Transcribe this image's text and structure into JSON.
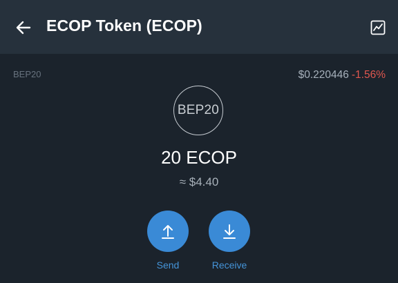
{
  "header": {
    "title": "ECOP Token (ECOP)",
    "back_icon": "arrow-left-icon",
    "chart_icon": "line-chart-icon"
  },
  "token": {
    "network": "BEP20",
    "price": "$0.220446",
    "change": "-1.56%",
    "logo_text": "BEP20",
    "balance": "20 ECOP",
    "fiat_value": "≈ $4.40"
  },
  "actions": {
    "send_label": "Send",
    "receive_label": "Receive"
  },
  "colors": {
    "background": "#1b232c",
    "header": "#26313c",
    "accent": "#3a8ad6",
    "negative": "#e0574f"
  }
}
